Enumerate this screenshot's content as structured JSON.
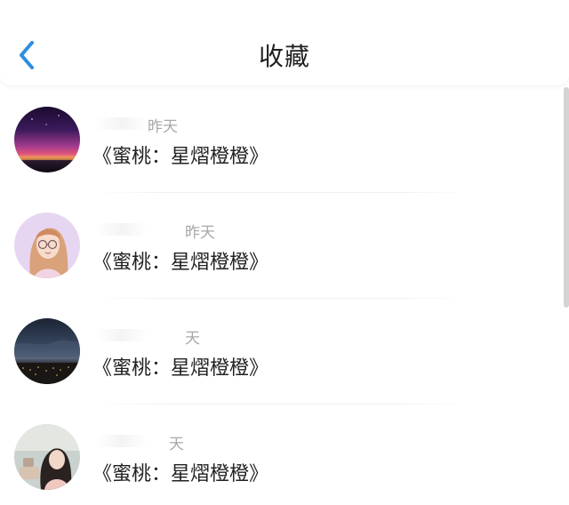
{
  "header": {
    "title": "收藏",
    "back_icon": "chevron-left-icon",
    "accent_color": "#2e8ee0"
  },
  "items": [
    {
      "time": "昨天",
      "title": "《蜜桃：星熠橙橙》",
      "avatar": "aurora-sunset-avatar"
    },
    {
      "time": "昨天",
      "title": "《蜜桃：星熠橙橙》",
      "avatar": "illustrated-girl-glasses-avatar"
    },
    {
      "time": "天",
      "title": "《蜜桃：星熠橙橙》",
      "avatar": "night-city-sky-avatar"
    },
    {
      "time": "天",
      "title": "《蜜桃：星熠橙橙》",
      "avatar": "woman-photo-avatar"
    }
  ]
}
